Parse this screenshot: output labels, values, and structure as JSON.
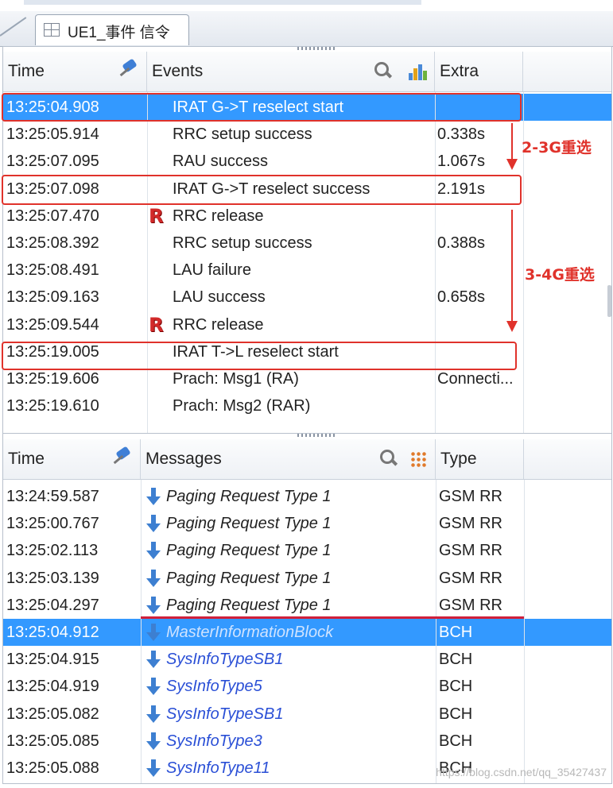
{
  "tab": {
    "label": "UE1_事件 信令"
  },
  "events_panel": {
    "headers": {
      "time": "Time",
      "events": "Events",
      "extra": "Extra"
    },
    "rows": [
      {
        "time": "13:25:04.908",
        "event": "IRAT G->T reselect start",
        "extra": "",
        "icon": "",
        "selected": true
      },
      {
        "time": "13:25:05.914",
        "event": "RRC setup success",
        "extra": "0.338s",
        "icon": ""
      },
      {
        "time": "13:25:07.095",
        "event": "RAU success",
        "extra": "1.067s",
        "icon": ""
      },
      {
        "time": "13:25:07.098",
        "event": "IRAT G->T reselect success",
        "extra": "2.191s",
        "icon": ""
      },
      {
        "time": "13:25:07.470",
        "event": "RRC release",
        "extra": "",
        "icon": "R"
      },
      {
        "time": "13:25:08.392",
        "event": "RRC setup success",
        "extra": "0.388s",
        "icon": ""
      },
      {
        "time": "13:25:08.491",
        "event": "LAU failure",
        "extra": "",
        "icon": ""
      },
      {
        "time": "13:25:09.163",
        "event": "LAU success",
        "extra": "0.658s",
        "icon": ""
      },
      {
        "time": "13:25:09.544",
        "event": "RRC release",
        "extra": "",
        "icon": "R"
      },
      {
        "time": "13:25:19.005",
        "event": "IRAT T->L reselect start",
        "extra": "",
        "icon": ""
      },
      {
        "time": "13:25:19.606",
        "event": "Prach: Msg1 (RA)",
        "extra": "Connecti...",
        "icon": ""
      },
      {
        "time": "13:25:19.610",
        "event": "Prach: Msg2 (RAR)",
        "extra": "",
        "icon": ""
      }
    ]
  },
  "messages_panel": {
    "headers": {
      "time": "Time",
      "messages": "Messages",
      "type": "Type"
    },
    "rows": [
      {
        "time": "13:24:59.587",
        "message": "Paging Request Type 1",
        "type": "GSM RR",
        "color": "dark"
      },
      {
        "time": "13:25:00.767",
        "message": "Paging Request Type 1",
        "type": "GSM RR",
        "color": "dark"
      },
      {
        "time": "13:25:02.113",
        "message": "Paging Request Type 1",
        "type": "GSM RR",
        "color": "dark"
      },
      {
        "time": "13:25:03.139",
        "message": "Paging Request Type 1",
        "type": "GSM RR",
        "color": "dark"
      },
      {
        "time": "13:25:04.297",
        "message": "Paging Request Type 1",
        "type": "GSM RR",
        "color": "dark"
      },
      {
        "time": "13:25:04.912",
        "message": "MasterInformationBlock",
        "type": "BCH",
        "color": "blue",
        "selected": true
      },
      {
        "time": "13:25:04.915",
        "message": "SysInfoTypeSB1",
        "type": "BCH",
        "color": "blue"
      },
      {
        "time": "13:25:04.919",
        "message": "SysInfoType5",
        "type": "BCH",
        "color": "blue"
      },
      {
        "time": "13:25:05.082",
        "message": "SysInfoTypeSB1",
        "type": "BCH",
        "color": "blue"
      },
      {
        "time": "13:25:05.085",
        "message": "SysInfoType3",
        "type": "BCH",
        "color": "blue"
      },
      {
        "time": "13:25:05.088",
        "message": "SysInfoType11",
        "type": "BCH",
        "color": "blue"
      }
    ]
  },
  "annotations": {
    "label_1": "2-3G重选",
    "label_2": "3-4G重选"
  },
  "watermark": "https://blog.csdn.net/qq_35427437",
  "colors": {
    "selection": "#3399ff",
    "annotation_red": "#e0322b",
    "message_blue": "#2a4fd6"
  }
}
